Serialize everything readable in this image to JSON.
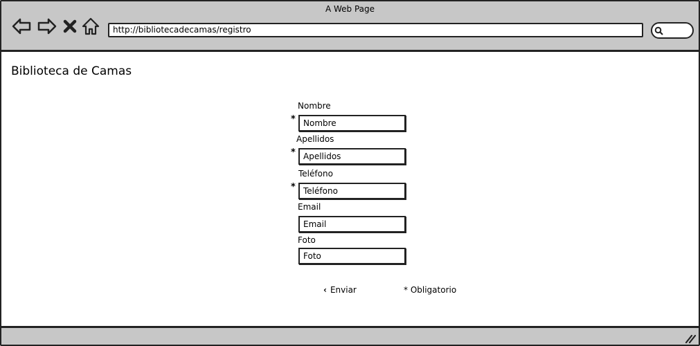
{
  "browser": {
    "window_title": "A Web Page",
    "url": "http://bibliotecadecamas/registro",
    "icons": [
      "back-arrow-icon",
      "forward-arrow-icon",
      "close-icon",
      "home-icon",
      "search-icon"
    ]
  },
  "page": {
    "title": "Biblioteca de Camas"
  },
  "form": {
    "required_mark": "*",
    "fields": [
      {
        "label": "Nombre",
        "placeholder": "Nombre",
        "required": true
      },
      {
        "label": "Apellidos",
        "placeholder": "Apellidos",
        "required": true
      },
      {
        "label": "Teléfono",
        "placeholder": "Teléfono",
        "required": true
      },
      {
        "label": "Email",
        "placeholder": "Email",
        "required": false
      },
      {
        "label": "Foto",
        "placeholder": "Foto",
        "required": false
      }
    ],
    "submit_label": "Enviar",
    "submit_icon": "chevron-left-icon",
    "required_note": "* Obligatorio"
  }
}
